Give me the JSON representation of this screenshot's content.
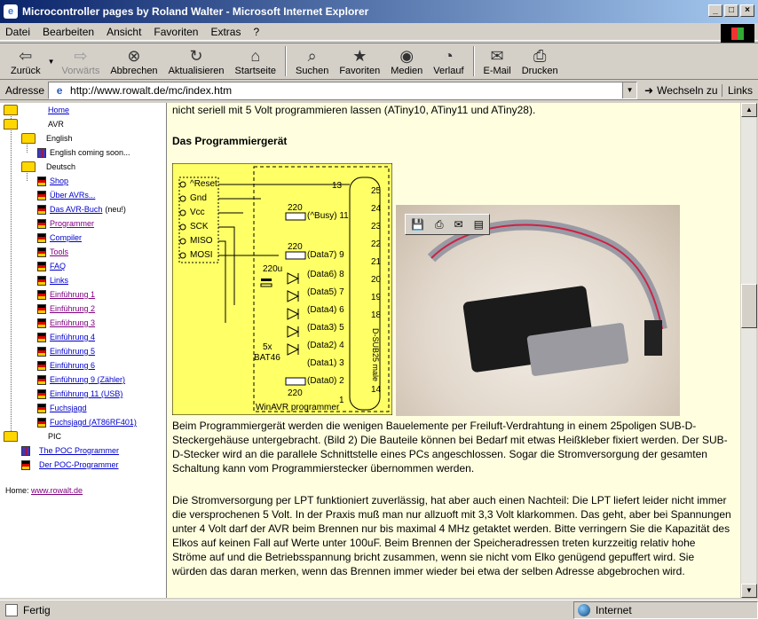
{
  "window": {
    "title": "Microcontroller pages by Roland Walter - Microsoft Internet Explorer",
    "buttons": [
      "_",
      "□",
      "×"
    ]
  },
  "menu": [
    "Datei",
    "Bearbeiten",
    "Ansicht",
    "Favoriten",
    "Extras",
    "?"
  ],
  "toolbar": {
    "back": "Zurück",
    "forward": "Vorwärts",
    "stop": "Abbrechen",
    "refresh": "Aktualisieren",
    "home": "Startseite",
    "search": "Suchen",
    "favorites": "Favoriten",
    "media": "Medien",
    "history": "Verlauf",
    "email": "E-Mail",
    "print": "Drucken"
  },
  "address": {
    "label": "Adresse",
    "url": "http://www.rowalt.de/mc/index.htm",
    "go": "Wechseln zu",
    "links": "Links"
  },
  "nav": {
    "home": "Home",
    "avr": "AVR",
    "english": "English",
    "english_soon": "English coming soon...",
    "deutsch": "Deutsch",
    "items": [
      {
        "label": "Shop",
        "style": "link"
      },
      {
        "label": "Über AVRs...",
        "style": "link"
      },
      {
        "label": "Das AVR-Buch",
        "style": "link",
        "suffix": "(neu!)"
      },
      {
        "label": "Programmer",
        "style": "visited"
      },
      {
        "label": "Compiler",
        "style": "link"
      },
      {
        "label": "Tools",
        "style": "visited"
      },
      {
        "label": "FAQ",
        "style": "link"
      },
      {
        "label": "Links",
        "style": "link"
      },
      {
        "label": "Einführung 1",
        "style": "visited"
      },
      {
        "label": "Einführung 2",
        "style": "visited"
      },
      {
        "label": "Einführung 3",
        "style": "visited"
      },
      {
        "label": "Einführung 4",
        "style": "link"
      },
      {
        "label": "Einführung 5",
        "style": "link"
      },
      {
        "label": "Einführung 6",
        "style": "link"
      },
      {
        "label": "Einführung 9 (Zähler)",
        "style": "link"
      },
      {
        "label": "Einführung 11 (USB)",
        "style": "link"
      },
      {
        "label": "Fuchsjagd",
        "style": "link"
      },
      {
        "label": "Fuchsjagd (AT86RF401)",
        "style": "link"
      }
    ],
    "pic": "PIC",
    "pic_items": [
      {
        "label": "The POC Programmer",
        "flag": "uk"
      },
      {
        "label": "Der POC-Programmer",
        "flag": "de"
      }
    ],
    "home_label": "Home:",
    "home_url": "www.rowalt.de"
  },
  "content": {
    "intro": "nicht seriell mit 5 Volt programmieren lassen (ATiny10, ATiny11 und ATiny28).",
    "heading": "Das Programmiergerät",
    "para1": "Beim Programmiergerät werden die wenigen Bauelemente per Freiluft-Verdrahtung in einem 25poligen SUB-D-Steckergehäuse untergebracht. (Bild 2) Die Bauteile können bei Bedarf mit etwas Heißkleber fixiert werden. Der SUB-D-Stecker wird an die parallele Schnittstelle eines PCs angeschlossen. Sogar die Stromversorgung der gesamten Schaltung kann vom Programmierstecker übernommen werden.",
    "para2": "Die Stromversorgung per LPT funktioniert zuverlässig, hat aber auch einen Nachteil: Die LPT liefert leider nicht immer die versprochenen 5 Volt. In der Praxis muß man nur allzuoft mit 3,3 Volt klarkommen. Das geht, aber bei Spannungen unter 4 Volt darf der AVR beim Brennen nur bis maximal 4 MHz getaktet werden. Bitte verringern Sie die Kapazität des Elkos auf keinen Fall auf Werte unter 100uF. Beim Brennen der Speicheradressen treten kurzzeitig relativ hohe Ströme auf und die Betriebsspannung bricht zusammen, wenn sie nicht vom Elko genügend gepuffert wird. Sie würden das daran merken, wenn das Brennen immer wieder bei etwa der selben Adresse abgebrochen wird."
  },
  "schematic": {
    "signals": [
      "^Reset",
      "Gnd",
      "Vcc",
      "SCK",
      "MISO",
      "MOSI"
    ],
    "resistor": "220",
    "cap": "220u",
    "diodes": "5x",
    "diode_type": "BAT46",
    "pins_right": [
      "13",
      "25",
      "24",
      "23",
      "22",
      "21",
      "20",
      "19",
      "18",
      "14"
    ],
    "pin_labels": [
      "(^Busy) 11",
      "(Data7) 9",
      "(Data6) 8",
      "(Data5) 7",
      "(Data4) 6",
      "(Data3) 5",
      "(Data2) 4",
      "(Data1) 3",
      "(Data0) 2"
    ],
    "pin_one": "1",
    "connector": "D-SUB25 male",
    "footer": "WinAVR programmer"
  },
  "status": {
    "text": "Fertig",
    "zone": "Internet"
  }
}
